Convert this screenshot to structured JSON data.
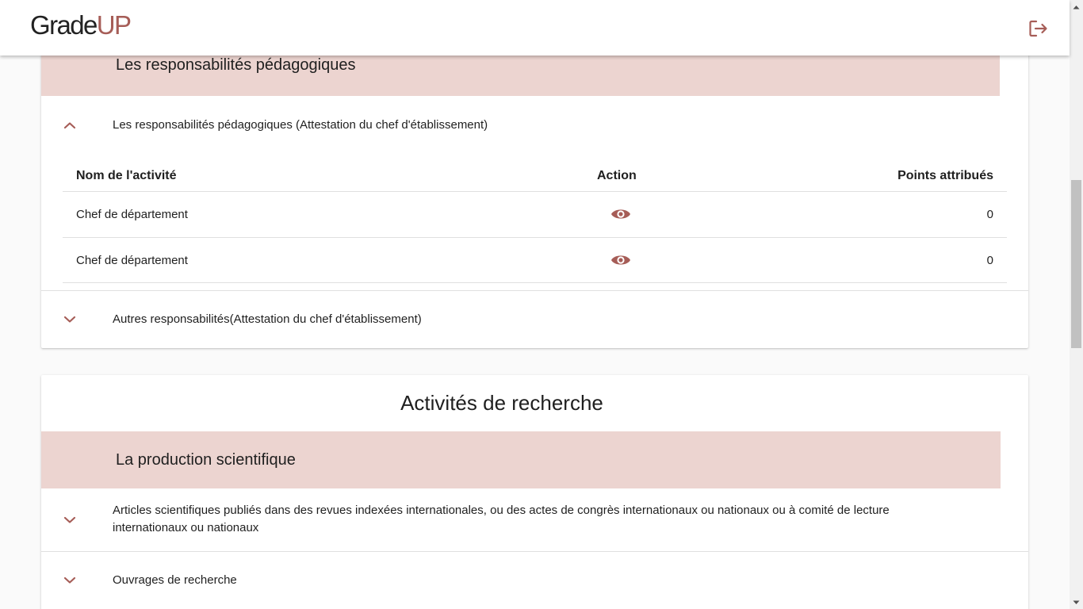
{
  "app": {
    "logo_part1": "Grade",
    "logo_part2": "UP",
    "brand_color": "#a65d57",
    "logout_icon": "logout-icon"
  },
  "colors": {
    "accent": "#a65d57",
    "band": "#ecd4d0"
  },
  "pedagogy": {
    "section_title": "Les responsabilités pédagogiques",
    "panels": [
      {
        "label": "Les responsabilités pédagogiques (Attestation du chef d'établissement)",
        "expanded": true,
        "table": {
          "headers": [
            "Nom de l'activité",
            "Action",
            "Points attribués"
          ],
          "rows": [
            {
              "name": "Chef de département",
              "action_icon": "eye-icon",
              "points": "0"
            },
            {
              "name": "Chef de département",
              "action_icon": "eye-icon",
              "points": "0"
            }
          ]
        }
      },
      {
        "label": "Autres responsabilités(Attestation du chef d'établissement)",
        "expanded": false
      }
    ]
  },
  "research": {
    "title": "Activités de recherche",
    "section_title": "La production scientifique",
    "panels": [
      {
        "label_line1": "Articles scientifiques publiés dans des revues indexées internationales, ou des actes de congrès internationaux ou nationaux ou à comité de lecture",
        "label_line2": "internationaux ou nationaux",
        "expanded": false
      },
      {
        "label": "Ouvrages de recherche",
        "expanded": false
      }
    ]
  }
}
